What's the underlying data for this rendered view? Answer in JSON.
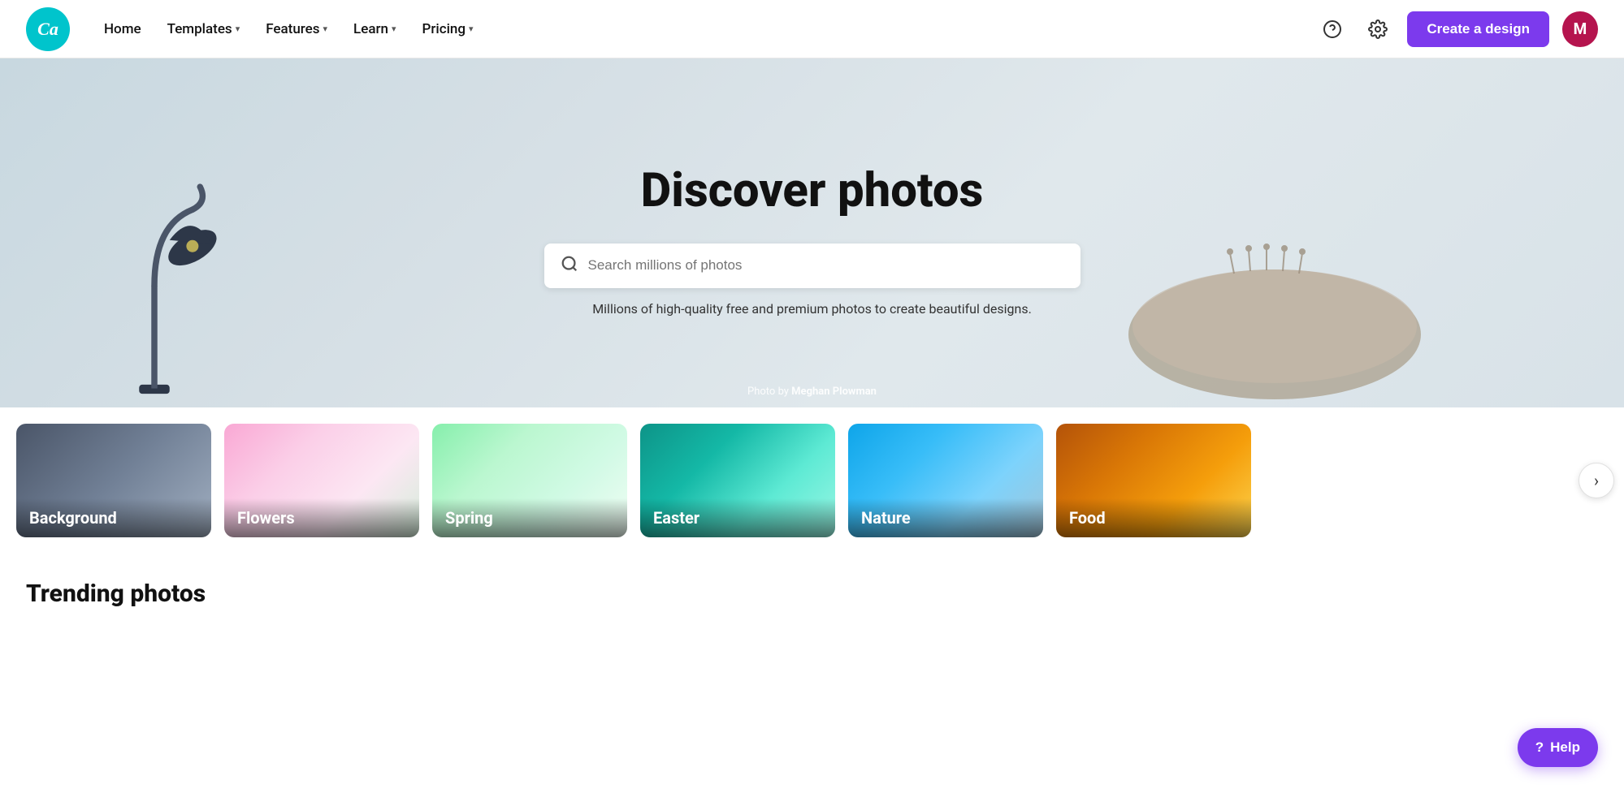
{
  "navbar": {
    "logo_text": "Canva",
    "home_label": "Home",
    "templates_label": "Templates",
    "features_label": "Features",
    "learn_label": "Learn",
    "pricing_label": "Pricing",
    "create_btn_label": "Create a design",
    "avatar_initial": "M",
    "help_tooltip": "Help",
    "settings_tooltip": "Settings"
  },
  "hero": {
    "title": "Discover photos",
    "search_placeholder": "Search millions of photos",
    "subtitle": "Millions of high-quality free and premium photos to create beautiful designs.",
    "photo_credit_prefix": "Photo by ",
    "photo_credit_name": "Meghan Plowman"
  },
  "categories": [
    {
      "id": "background",
      "label": "Background",
      "bg_class": "cat-bg-background"
    },
    {
      "id": "flowers",
      "label": "Flowers",
      "bg_class": "cat-bg-flowers"
    },
    {
      "id": "spring",
      "label": "Spring",
      "bg_class": "cat-bg-spring"
    },
    {
      "id": "easter",
      "label": "Easter",
      "bg_class": "cat-bg-easter"
    },
    {
      "id": "nature",
      "label": "Nature",
      "bg_class": "cat-bg-nature"
    },
    {
      "id": "food",
      "label": "Food",
      "bg_class": "cat-bg-food"
    }
  ],
  "scroll_arrow": "›",
  "trending_title": "Trending photos",
  "help_label": "Help",
  "help_icon": "?"
}
